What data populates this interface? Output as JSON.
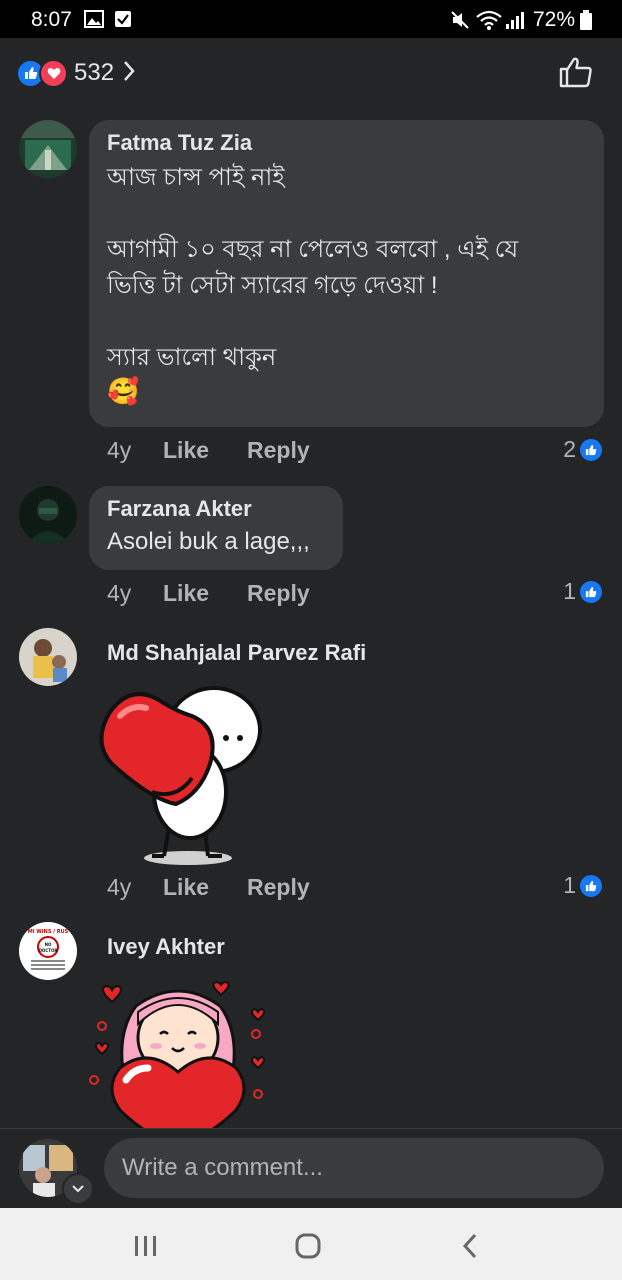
{
  "status_bar": {
    "time": "8:07",
    "battery": "72%"
  },
  "reactions": {
    "count": "532"
  },
  "comments": [
    {
      "author": "Fatma Tuz Zia",
      "text": "আজ চান্স পাই নাই\n\nআগামী ১০ বছর না পেলেও বলবো , এই যে\nভিত্তি টা সেটা স্যারের গড়ে দেওয়া !\n\nস্যার ভালো থাকুন",
      "emoji": "🥰",
      "age": "4y",
      "like": "Like",
      "reply": "Reply",
      "reaction_count": "2"
    },
    {
      "author": "Farzana Akter",
      "text": "Asolei buk a lage,,,",
      "age": "4y",
      "like": "Like",
      "reply": "Reply",
      "reaction_count": "1"
    },
    {
      "author": "Md Shahjalal Parvez Rafi",
      "sticker": "heart-hug-sticker",
      "age": "4y",
      "like": "Like",
      "reply": "Reply",
      "reaction_count": "1"
    },
    {
      "author": "Ivey Akhter",
      "sticker": "girl-heart-sticker",
      "avatar_text": [
        "MI WINS / RUS",
        "NO",
        "DOCTOR"
      ]
    }
  ],
  "composer": {
    "placeholder": "Write a comment..."
  },
  "colors": {
    "background": "#242526",
    "bubble": "#3a3b3c",
    "like_blue": "#1877f2",
    "love_red": "#f33e58"
  }
}
